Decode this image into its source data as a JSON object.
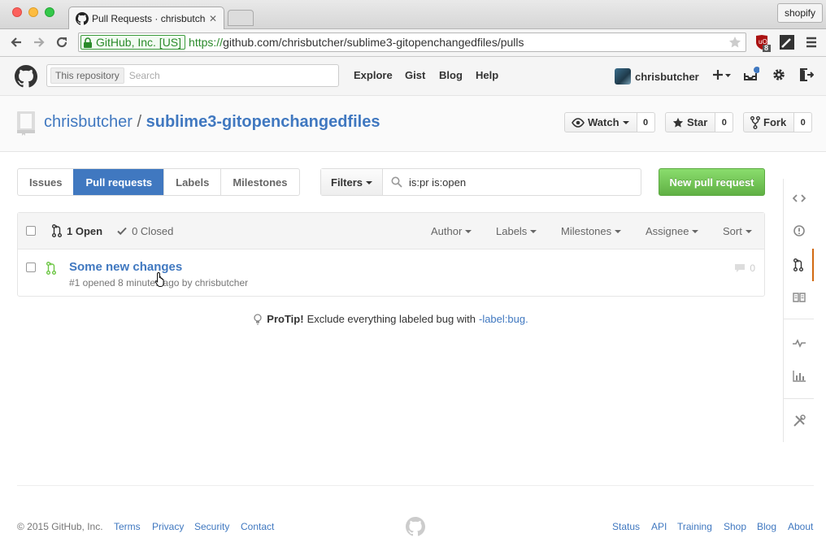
{
  "browser": {
    "tab_title": "Pull Requests · chrisbutcher",
    "tab_close": "✕",
    "profile": "shopify",
    "ev_org": "GitHub, Inc. [US]",
    "url_scheme": "https://",
    "url_rest": "github.com/chrisbutcher/sublime3-gitopenchangedfiles/pulls",
    "extension_badge": "8",
    "icons": [
      "back-arrow-icon",
      "forward-arrow-icon",
      "reload-icon",
      "lock-icon",
      "star-icon",
      "ublock-icon",
      "pencil-icon",
      "hamburger-menu-icon"
    ]
  },
  "header": {
    "search_scope": "This repository",
    "search_placeholder": "Search",
    "nav": [
      "Explore",
      "Gist",
      "Blog",
      "Help"
    ],
    "username": "chrisbutcher"
  },
  "repo": {
    "owner": "chrisbutcher",
    "separator": "/",
    "name": "sublime3-gitopenchangedfiles",
    "watch_label": "Watch",
    "watch_count": "0",
    "star_label": "Star",
    "star_count": "0",
    "fork_label": "Fork",
    "fork_count": "0"
  },
  "subnav": {
    "items": [
      "Issues",
      "Pull requests",
      "Labels",
      "Milestones"
    ],
    "selected": "Pull requests",
    "filters_label": "Filters",
    "filter_query": "is:pr is:open",
    "new_pr_label": "New pull request"
  },
  "listing": {
    "open_label": "1 Open",
    "closed_label": "0 Closed",
    "filter_menus": [
      "Author",
      "Labels",
      "Milestones",
      "Assignee",
      "Sort"
    ],
    "pr": {
      "title": "Some new changes",
      "meta": "#1 opened 8 minutes ago by chrisbutcher",
      "comments": "0"
    }
  },
  "protip": {
    "lead": "ProTip!",
    "text": "Exclude everything labeled bug with",
    "link": "-label:bug."
  },
  "footer": {
    "copyright": "© 2015 GitHub, Inc.",
    "left_links": [
      "Terms",
      "Privacy",
      "Security",
      "Contact"
    ],
    "right_links": [
      "Status",
      "API",
      "Training",
      "Shop",
      "Blog",
      "About"
    ]
  },
  "colors": {
    "link": "#4078c0",
    "green": "#6cc644",
    "selected_tab": "#4078c0",
    "sidenav_accent": "#d26911"
  }
}
